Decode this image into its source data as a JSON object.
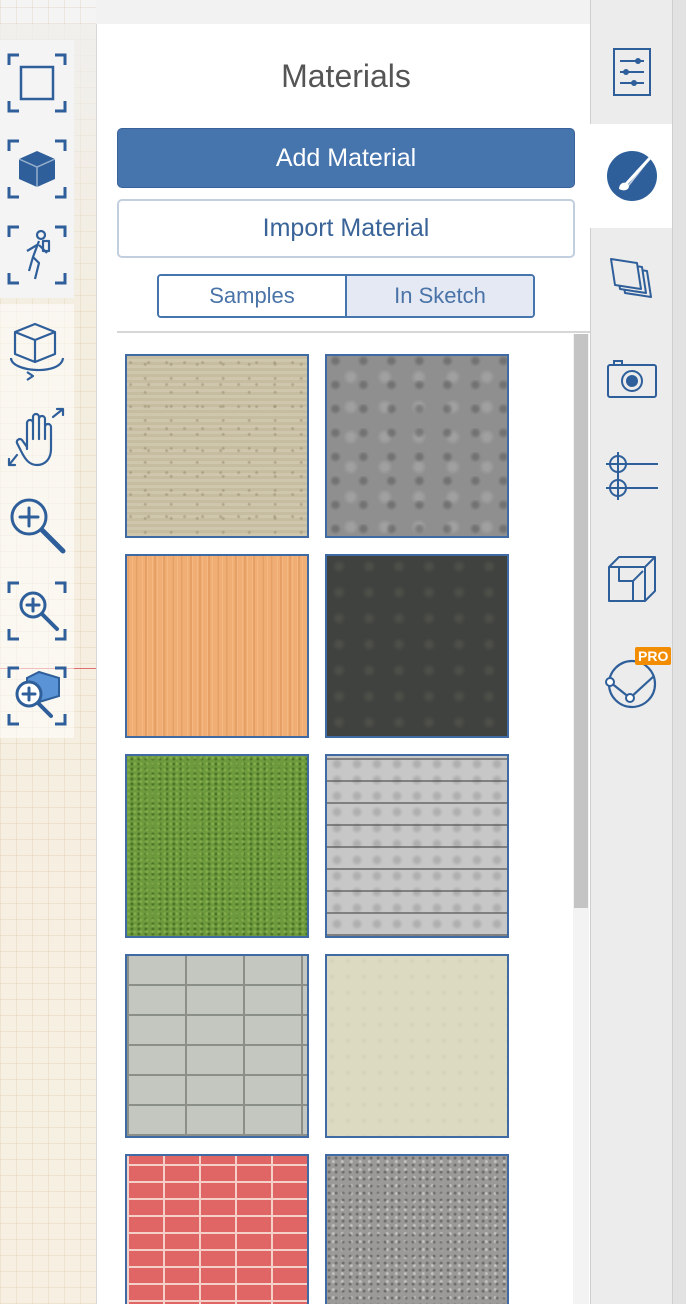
{
  "panel": {
    "title": "Materials",
    "add_button": "Add Material",
    "import_button": "Import Material",
    "tabs": [
      {
        "label": "Samples",
        "active": false
      },
      {
        "label": "In Sketch",
        "active": true
      }
    ]
  },
  "swatches": [
    {
      "material": "sand-plaster"
    },
    {
      "material": "gray-concrete"
    },
    {
      "material": "light-wood"
    },
    {
      "material": "dark-slate"
    },
    {
      "material": "grass"
    },
    {
      "material": "board-formed-concrete"
    },
    {
      "material": "concrete-block"
    },
    {
      "material": "cream-stucco"
    },
    {
      "material": "red-brick"
    },
    {
      "material": "gravel"
    }
  ],
  "left_toolbar": {
    "tools": [
      "select-tool-icon",
      "object-tool-icon",
      "walk-tool-icon",
      "orbit-icon",
      "pan-icon",
      "zoom-icon",
      "zoom-window-icon",
      "zoom-extents-icon"
    ]
  },
  "right_tabs": {
    "items": [
      "settings-sliders-icon",
      "materials-brush-icon",
      "layers-icon",
      "camera-icon",
      "guides-icon",
      "section-cube-icon",
      "pro-curve-icon"
    ],
    "active": "materials-brush-icon",
    "pro_badge": "PRO"
  },
  "colors": {
    "accent": "#4674ad",
    "panel_bg": "#ffffff",
    "tabbar_bg": "#ececec",
    "pro_badge": "#f28c00"
  }
}
